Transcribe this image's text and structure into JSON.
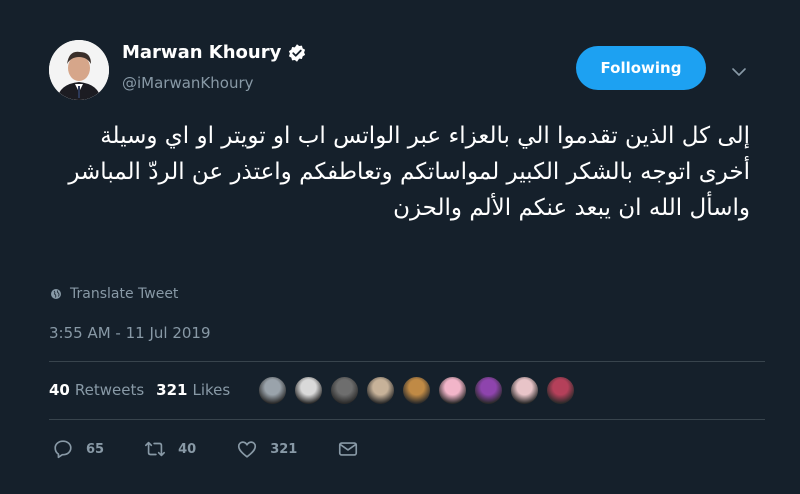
{
  "user": {
    "display_name": "Marwan Khoury",
    "handle": "@iMarwanKhoury",
    "verified": true
  },
  "follow_button": {
    "label": "Following"
  },
  "tweet": {
    "text": "إلى كل الذين تقدموا الي بالعزاء عبر الواتس اب او تويتر او اي وسيلة أخرى اتوجه بالشكر الكبير لمواساتكم وتعاطفكم واعتذر عن الردّ المباشر واسأل الله ان يبعد عنكم الألم والحزن",
    "translate_label": "Translate Tweet",
    "timestamp": "3:55 AM - 11 Jul 2019"
  },
  "stats": {
    "retweets_count": "40",
    "retweets_label": "Retweets",
    "likes_count": "321",
    "likes_label": "Likes"
  },
  "likers": [
    {
      "color": "#9aa3ab"
    },
    {
      "color": "#d9d9d9"
    },
    {
      "color": "#6e6e6e"
    },
    {
      "color": "#c7b299"
    },
    {
      "color": "#c08a45"
    },
    {
      "color": "#f2b5c9"
    },
    {
      "color": "#8e44ad"
    },
    {
      "color": "#e8c4c8"
    },
    {
      "color": "#b5405a"
    }
  ],
  "actions": {
    "reply_count": "65",
    "retweet_count": "40",
    "like_count": "321"
  },
  "colors": {
    "background": "#15202b",
    "accent": "#1da1f2",
    "secondary_text": "#8899a6",
    "divider": "#38444d"
  }
}
